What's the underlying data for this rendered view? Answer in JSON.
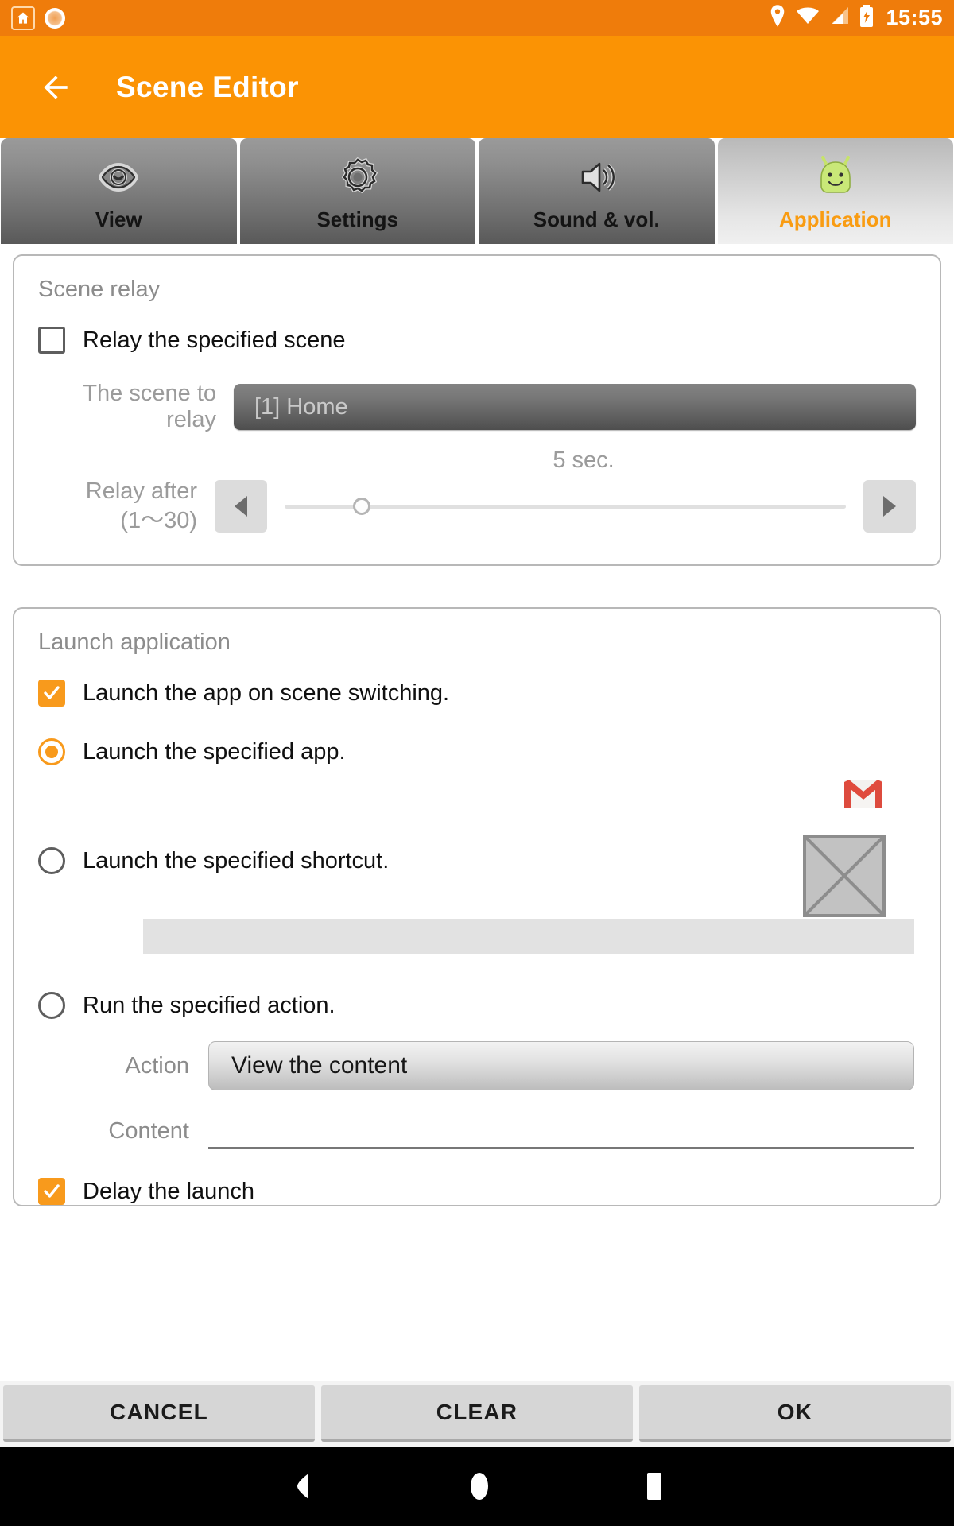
{
  "status_bar": {
    "time": "15:55",
    "icons": [
      "home-app-icon",
      "record-circle-icon",
      "location-pin-icon",
      "wifi-icon",
      "cellular-signal-icon",
      "battery-charging-icon"
    ]
  },
  "app_bar": {
    "back_icon": "back-arrow-icon",
    "title": "Scene Editor"
  },
  "tabs": [
    {
      "label": "View",
      "icon": "eye-icon",
      "active": false
    },
    {
      "label": "Settings",
      "icon": "gear-icon",
      "active": false
    },
    {
      "label": "Sound & vol.",
      "icon": "speaker-volume-icon",
      "active": false
    },
    {
      "label": "Application",
      "icon": "android-robot-icon",
      "active": true
    }
  ],
  "scene_relay": {
    "title": "Scene relay",
    "relay_checkbox": {
      "label": "Relay the specified scene",
      "checked": false
    },
    "scene_to_relay": {
      "label": "The scene to relay",
      "value": "[1] Home"
    },
    "relay_after": {
      "label_line1": "Relay after",
      "label_line2": "(1〜30)",
      "value_text": "5 sec.",
      "min": 1,
      "max": 30,
      "value": 5,
      "decrement_icon": "left-triangle-icon",
      "increment_icon": "right-triangle-icon"
    }
  },
  "launch_application": {
    "title": "Launch application",
    "launch_on_switch": {
      "label": "Launch the app on scene switching.",
      "checked": true
    },
    "options": [
      {
        "label": "Launch the specified app.",
        "selected": true,
        "icon": "gmail-icon"
      },
      {
        "label": "Launch the specified shortcut.",
        "selected": false,
        "icon": "broken-image-placeholder-icon"
      },
      {
        "label": "Run the specified action.",
        "selected": false
      }
    ],
    "shortcut_name_field": {
      "value": ""
    },
    "action": {
      "label": "Action",
      "value": "View the content"
    },
    "content": {
      "label": "Content",
      "value": ""
    },
    "delay_launch": {
      "label": "Delay the launch",
      "checked": true
    }
  },
  "buttons": {
    "cancel": "CANCEL",
    "clear": "CLEAR",
    "ok": "OK"
  },
  "nav_bar": {
    "back": "nav-back-icon",
    "home": "nav-home-icon",
    "recents": "nav-recents-icon"
  },
  "colors": {
    "status_bar": "#ef7c0b",
    "app_bar": "#fb9304",
    "accent": "#f89a1c",
    "active_tab_text": "#f99c12"
  }
}
